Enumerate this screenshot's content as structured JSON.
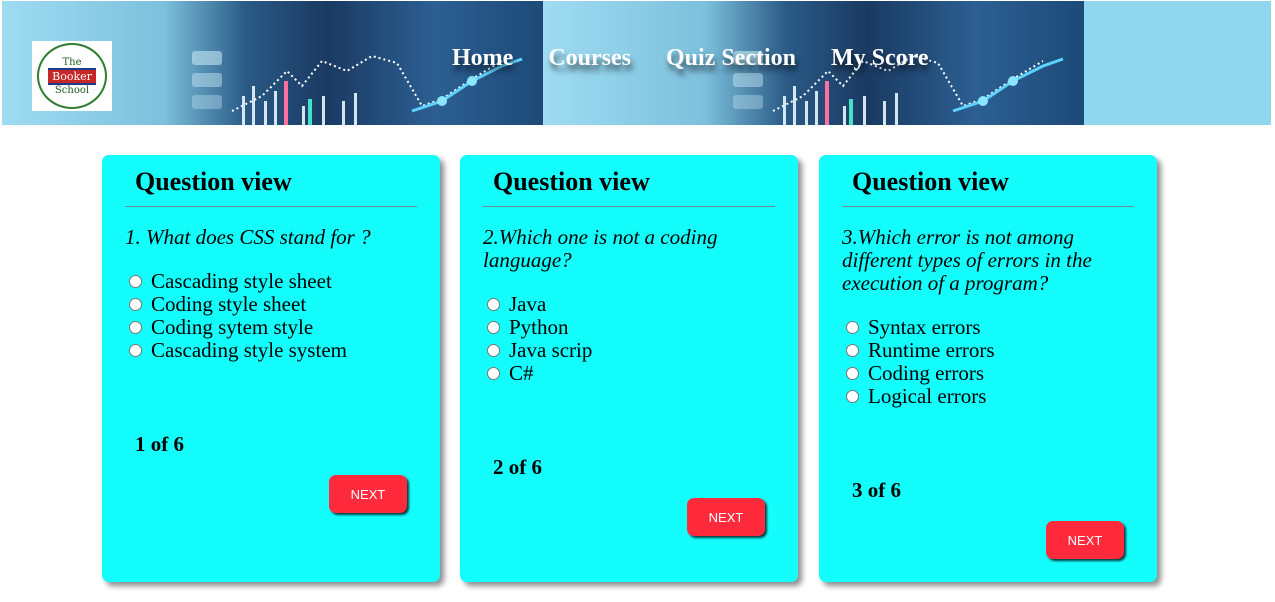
{
  "header": {
    "logo": {
      "line1": "The",
      "line2": "Booker",
      "line3": "School"
    },
    "nav": [
      "Home",
      "Courses",
      "Quiz Section",
      "My Score"
    ]
  },
  "cards": [
    {
      "title": "Question view",
      "question": "1. What does CSS stand for ?",
      "options": [
        "Cascading style sheet",
        "Coding style sheet",
        "Coding sytem style",
        "Cascading style system"
      ],
      "counter": "1 of 6",
      "next_label": "NEXT"
    },
    {
      "title": "Question view",
      "question": "2.Which one is not a coding language?",
      "options": [
        "Java",
        "Python",
        "Java scrip",
        "C#"
      ],
      "counter": "2 of 6",
      "next_label": "NEXT"
    },
    {
      "title": "Question view",
      "question": "3.Which error is not among different types of errors in the execution of a program?",
      "options": [
        "Syntax errors",
        "Runtime errors",
        "Coding errors",
        "Logical errors"
      ],
      "counter": "3 of 6",
      "next_label": "NEXT"
    }
  ],
  "colors": {
    "card_bg": "#14fdfd",
    "next_button": "#ff2a3c",
    "header_bg": "#8fd6ee"
  }
}
